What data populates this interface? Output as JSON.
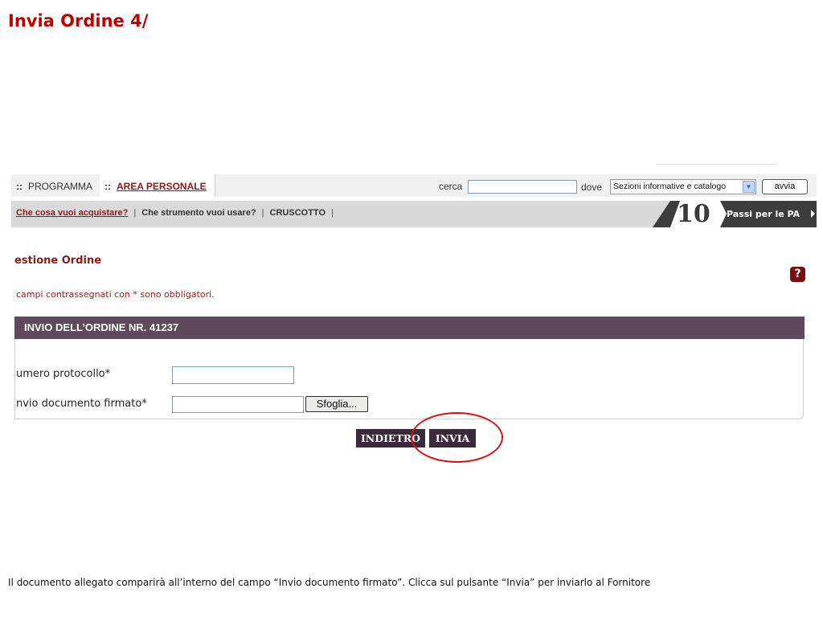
{
  "slide": {
    "title": "Invia Ordine 4/",
    "caption": "Il documento allegato comparirà all’interno del campo “Invio documento firmato”. Clicca sul pulsante “Invia” per inviarlo al Fornitore"
  },
  "nav": {
    "separator": "::",
    "tab_programma": "PROGRAMMA",
    "tab_area_personale": "AREA PERSONALE",
    "cerca_label": "cerca",
    "cerca_value": "",
    "dove_label": "dove",
    "dove_selected": "Sezioni informative e catalogo",
    "avvia_label": "avvia"
  },
  "subnav": {
    "items": [
      "Che cosa vuoi acquistare?",
      "Che strumento vuoi usare?",
      "CRUSCOTTO"
    ],
    "separator": "|",
    "badge_number": "10",
    "badge_text": "Passi per le PA"
  },
  "page": {
    "heading": "estione Ordine",
    "required_note": "campi contrassegnati con * sono obbligatori.",
    "help_icon": "?",
    "section_title": "INVIO DELL’ORDINE NR. 41237"
  },
  "form": {
    "numero_label": "umero protocollo*",
    "numero_value": "",
    "doc_label": "nvio documento firmato*",
    "doc_value": "",
    "browse_label": "Sfoglia..."
  },
  "actions": {
    "back_label": "INDIETRO",
    "send_label": "INVIA"
  },
  "colors": {
    "title_red": "#c00000",
    "brand_dark_red": "#8b1a1a",
    "section_bar": "#5f4a5b",
    "button_bg": "#3a2a3a",
    "highlight_circle": "#e01010"
  },
  "icons": {
    "help": "help-icon",
    "dropdown": "chevron-down-icon",
    "badge_arrow": "triangle-right-icon"
  }
}
